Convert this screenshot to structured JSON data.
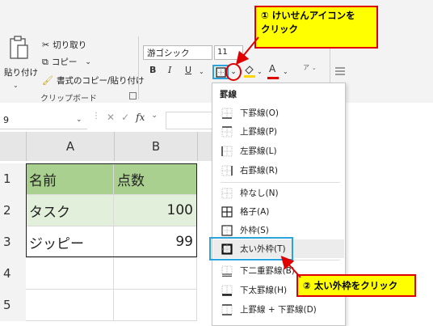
{
  "clipboard": {
    "paste_label": "貼り付け",
    "cut_label": "切り取り",
    "copy_label": "コピー",
    "format_painter_label": "書式のコピー/貼り付け",
    "group_label": "クリップボード"
  },
  "font": {
    "name_value": "游ゴシック",
    "size_value": "11",
    "bold": "B",
    "italic": "I",
    "underline": "U",
    "font_color_letter": "A",
    "phonetic": "ア"
  },
  "callouts": {
    "step1_line1": "① けいせんアイコンを",
    "step1_line2": "クリック",
    "step2": "② 太い外枠をクリック"
  },
  "formula_bar": {
    "name_box_value": "9",
    "fx_label": "fx"
  },
  "sheet": {
    "columns": [
      "A",
      "B"
    ],
    "rows": [
      {
        "num": "1",
        "a": "名前",
        "b": "点数"
      },
      {
        "num": "2",
        "a": "タスク",
        "b": "100"
      },
      {
        "num": "3",
        "a": "ジッピー",
        "b": "99"
      },
      {
        "num": "4",
        "a": "",
        "b": ""
      },
      {
        "num": "5",
        "a": "",
        "b": ""
      }
    ],
    "colors": {
      "header": "#a9d08e",
      "band": "#e2efda"
    }
  },
  "border_menu": {
    "heading": "罫線",
    "items": [
      {
        "label": "下罫線(O)",
        "icon": "bottom-border-icon"
      },
      {
        "label": "上罫線(P)",
        "icon": "top-border-icon"
      },
      {
        "label": "左罫線(L)",
        "icon": "left-border-icon"
      },
      {
        "label": "右罫線(R)",
        "icon": "right-border-icon"
      },
      {
        "label": "枠なし(N)",
        "icon": "no-border-icon"
      },
      {
        "label": "格子(A)",
        "icon": "all-borders-icon"
      },
      {
        "label": "外枠(S)",
        "icon": "outside-borders-icon"
      },
      {
        "label": "太い外枠(T)",
        "icon": "thick-outside-borders-icon"
      },
      {
        "label": "下二重罫線(B)",
        "icon": "bottom-double-border-icon"
      },
      {
        "label": "下太罫線(H)",
        "icon": "thick-bottom-border-icon"
      },
      {
        "label": "上罫線 + 下罫線(D)",
        "icon": "top-and-bottom-border-icon"
      }
    ]
  },
  "accent_colors": {
    "callout_fill": "#ffff00",
    "callout_border": "#e00000",
    "highlight_box": "#2aa3de"
  }
}
